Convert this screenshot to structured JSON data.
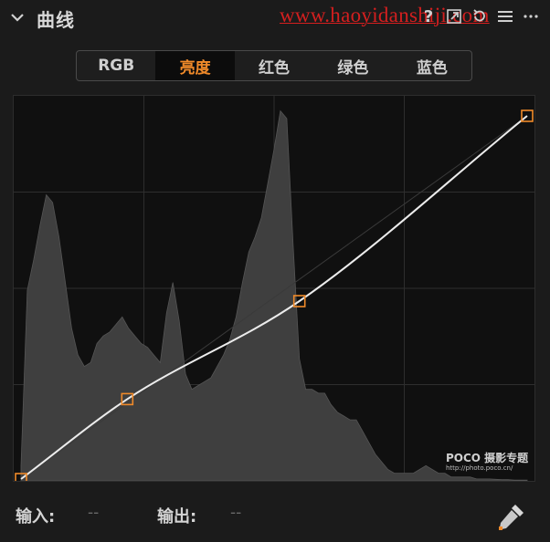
{
  "header": {
    "title": "曲线",
    "watermark": "www.haoyidanshiji.com",
    "icons": [
      "chevron-down-icon",
      "help-icon",
      "expand-icon",
      "reset-icon",
      "menu-icon",
      "more-icon"
    ],
    "help_glyph": "?"
  },
  "tabs": [
    {
      "label": "RGB",
      "active": false
    },
    {
      "label": "亮度",
      "active": true
    },
    {
      "label": "红色",
      "active": false
    },
    {
      "label": "绿色",
      "active": false
    },
    {
      "label": "蓝色",
      "active": false
    }
  ],
  "graph": {
    "points": [
      [
        0,
        0
      ],
      [
        0.21,
        0.22
      ],
      [
        0.55,
        0.49
      ],
      [
        1,
        1
      ]
    ],
    "histogram": [
      0.04,
      0.5,
      0.58,
      0.67,
      0.75,
      0.73,
      0.64,
      0.52,
      0.4,
      0.33,
      0.3,
      0.31,
      0.36,
      0.38,
      0.39,
      0.41,
      0.43,
      0.4,
      0.38,
      0.36,
      0.35,
      0.33,
      0.31,
      0.44,
      0.52,
      0.42,
      0.28,
      0.24,
      0.25,
      0.26,
      0.27,
      0.3,
      0.33,
      0.37,
      0.43,
      0.52,
      0.6,
      0.64,
      0.69,
      0.78,
      0.87,
      0.97,
      0.95,
      0.62,
      0.32,
      0.24,
      0.24,
      0.23,
      0.23,
      0.2,
      0.18,
      0.17,
      0.16,
      0.16,
      0.13,
      0.1,
      0.07,
      0.05,
      0.03,
      0.02,
      0.02,
      0.02,
      0.02,
      0.03,
      0.04,
      0.03,
      0.02,
      0.02,
      0.01,
      0.01,
      0.01,
      0.01,
      0.005,
      0.005,
      0.005,
      0.004,
      0.003,
      0.003,
      0.002,
      0.002,
      0.002
    ],
    "accent": "#f08a2a",
    "curve_color": "#ececec"
  },
  "watermark_logo": {
    "text": "POCO 摄影专题",
    "url": "http://photo.poco.cn/"
  },
  "footer": {
    "input_label": "输入:",
    "input_value": "--",
    "output_label": "输出:",
    "output_value": "--"
  }
}
